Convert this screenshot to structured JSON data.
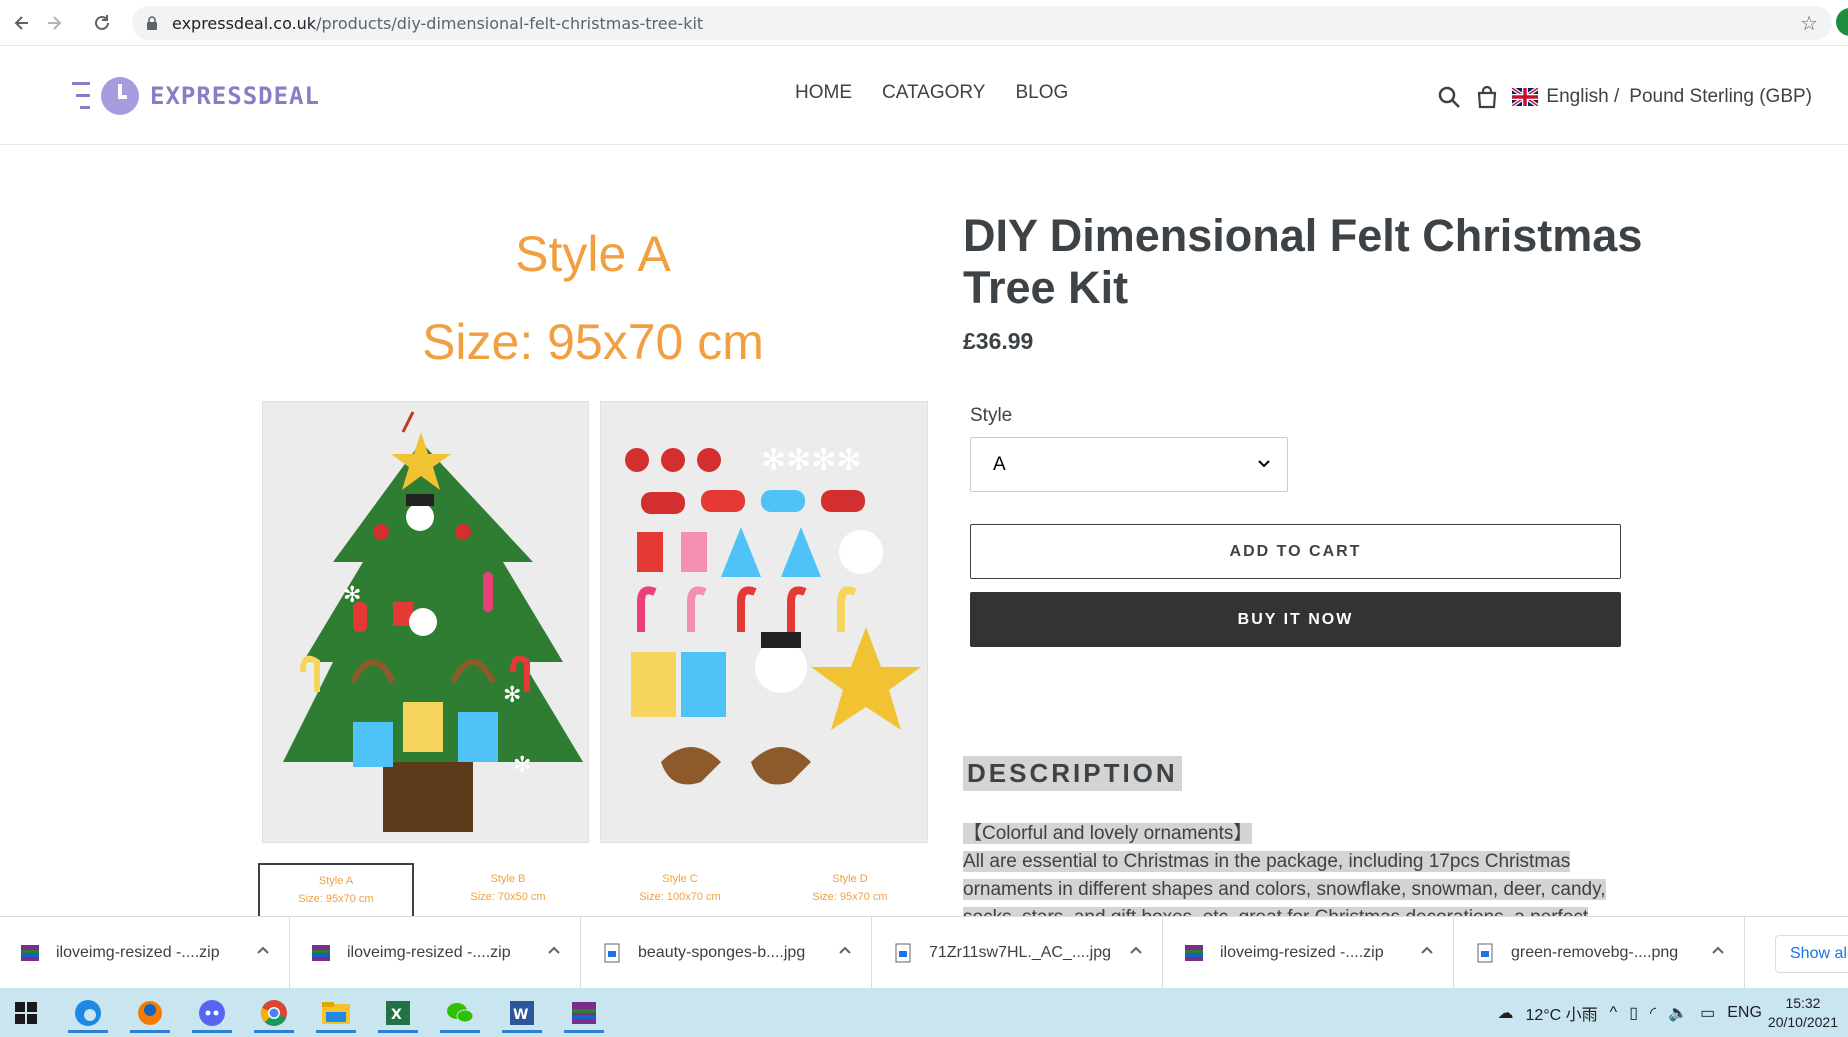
{
  "browser": {
    "url_domain": "expressdeal.co.uk",
    "url_path": "/products/diy-dimensional-felt-christmas-tree-kit",
    "back_icon": "arrow-left-icon",
    "forward_icon": "arrow-right-icon",
    "reload_icon": "reload-icon"
  },
  "header": {
    "logo_text": "EXPRESSDEAL",
    "nav": [
      "HOME",
      "CATAGORY",
      "BLOG"
    ],
    "language": "English /",
    "currency": "Pound Sterling (GBP)"
  },
  "gallery": {
    "style_label": "Style A",
    "size_label": "Size: 95x70 cm",
    "thumbs": [
      {
        "style": "Style A",
        "size": "Size: 95x70 cm"
      },
      {
        "style": "Style B",
        "size": "Size: 70x50 cm"
      },
      {
        "style": "Style C",
        "size": "Size: 100x70 cm"
      },
      {
        "style": "Style D",
        "size": "Size: 95x70 cm"
      }
    ]
  },
  "product": {
    "title": "DIY Dimensional Felt Christmas Tree Kit",
    "price": "£36.99",
    "option_label": "Style",
    "option_value": "A",
    "add_to_cart": "ADD TO CART",
    "buy_now": "BUY IT NOW",
    "description_heading": "DESCRIPTION",
    "description_line1": "【Colorful and lovely ornaments】",
    "description_line2": "All are essential to Christmas in the package, including 17pcs Christmas",
    "description_line3": "ornaments in different shapes and colors, snowflake, snowman, deer, candy,",
    "description_line4": "socks, stars, and gift boxes, etc. great for Christmas decorations, a perfect"
  },
  "downloads": {
    "items": [
      "iloveimg-resized -....zip",
      "iloveimg-resized -....zip",
      "beauty-sponges-b....jpg",
      "71Zr11sw7HL._AC_....jpg",
      "iloveimg-resized -....zip",
      "green-removebg-....png"
    ],
    "show_all": "Show all"
  },
  "taskbar": {
    "weather": "12°C 小雨",
    "lang": "ENG",
    "time": "15:32",
    "date": "20/10/2021"
  }
}
